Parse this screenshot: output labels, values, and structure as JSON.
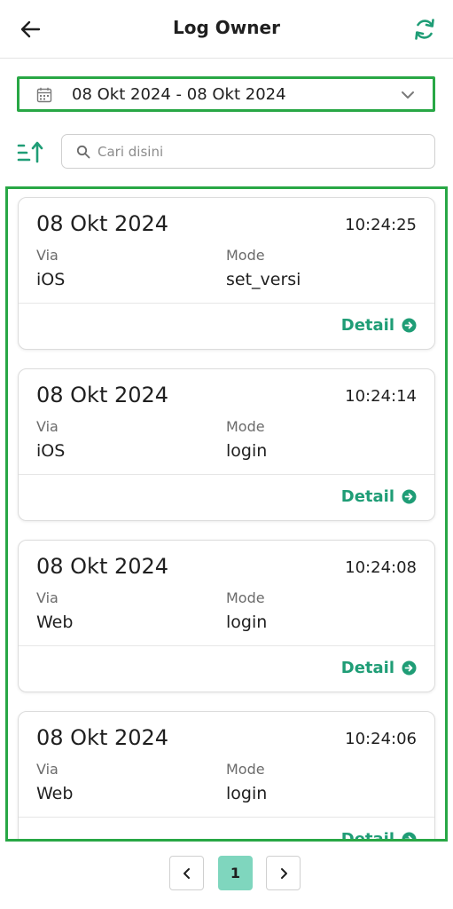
{
  "header": {
    "title": "Log Owner",
    "back_icon": "arrow-left-icon",
    "refresh_icon": "refresh-icon"
  },
  "filter": {
    "date_range": "08 Okt 2024 - 08 Okt 2024",
    "calendar_icon": "calendar-icon",
    "dropdown_icon": "chevron-down-icon"
  },
  "search": {
    "placeholder": "Cari disini",
    "value": "",
    "sort_icon": "sort-ascending-icon",
    "search_icon": "search-icon"
  },
  "colors": {
    "accent": "#1f9d76",
    "highlight_border": "#28a745",
    "active_page": "#7fd6be"
  },
  "labels": {
    "via": "Via",
    "mode": "Mode",
    "detail": "Detail"
  },
  "logs": [
    {
      "date": "08 Okt 2024",
      "time": "10:24:25",
      "via": "iOS",
      "mode": "set_versi"
    },
    {
      "date": "08 Okt 2024",
      "time": "10:24:14",
      "via": "iOS",
      "mode": "login"
    },
    {
      "date": "08 Okt 2024",
      "time": "10:24:08",
      "via": "Web",
      "mode": "login"
    },
    {
      "date": "08 Okt 2024",
      "time": "10:24:06",
      "via": "Web",
      "mode": "login"
    }
  ],
  "pagination": {
    "current_page": "1",
    "prev_icon": "chevron-left-icon",
    "next_icon": "chevron-right-icon"
  }
}
